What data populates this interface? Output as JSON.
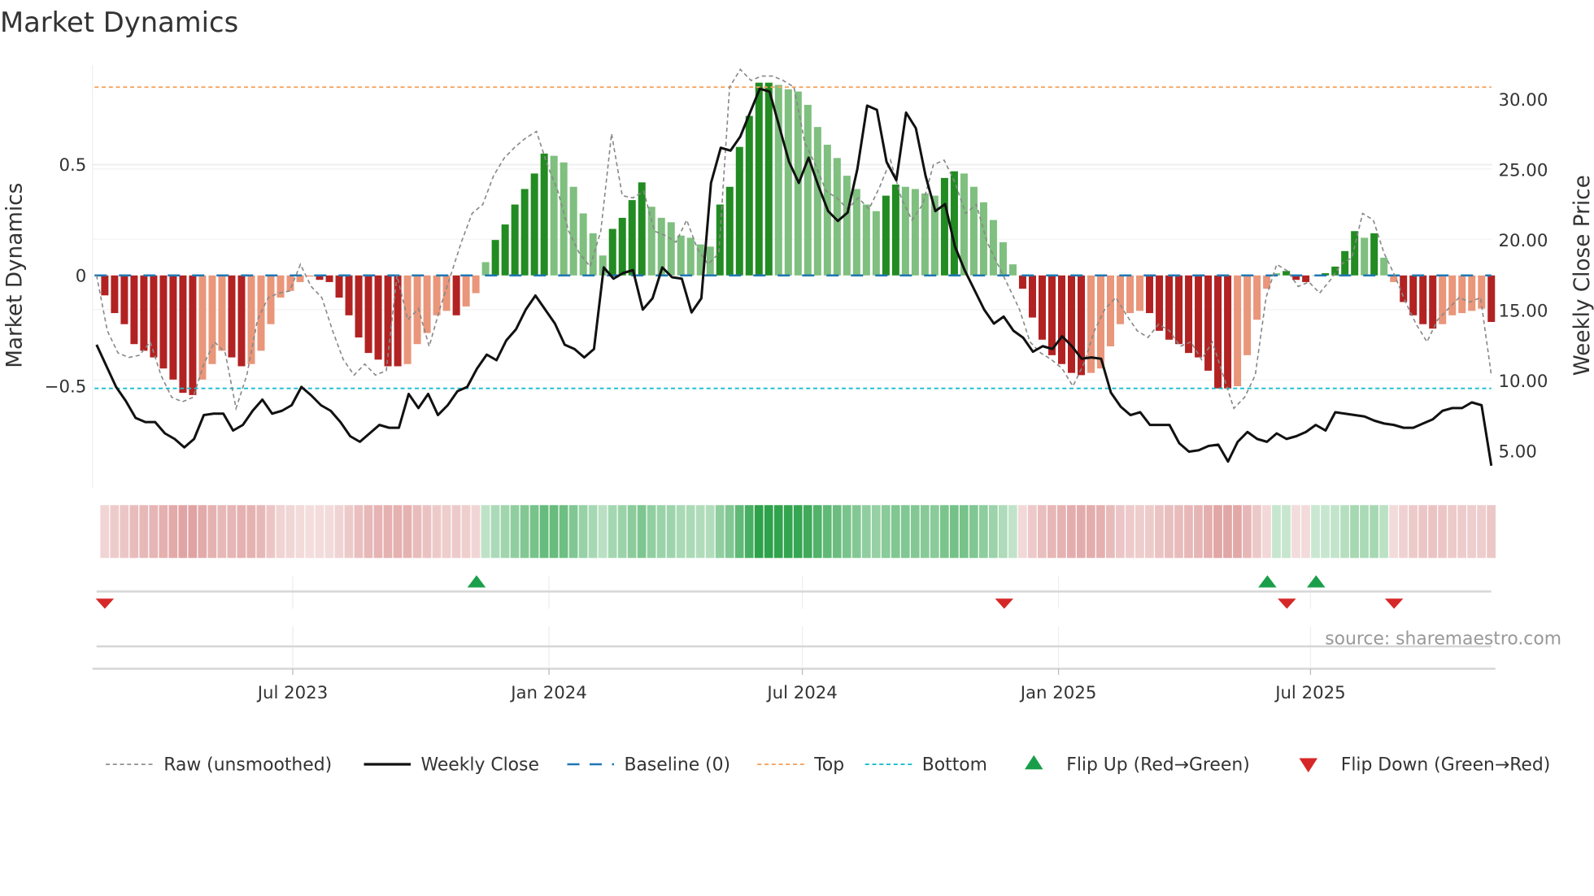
{
  "chart_data": {
    "type": "bar",
    "title": "Market Dynamics",
    "ylabel": "Market Dynamics",
    "y2label": "Weekly Close Price",
    "ylim": [
      -0.95,
      0.95
    ],
    "y2lim": [
      2.0,
      32.0
    ],
    "yticks": [
      {
        "v": 0.5,
        "label": "0.5"
      },
      {
        "v": 0,
        "label": "0"
      },
      {
        "v": -0.5,
        "label": "−0.5"
      }
    ],
    "y2ticks": [
      {
        "v": 30,
        "label": "30.00"
      },
      {
        "v": 25,
        "label": "25.00"
      },
      {
        "v": 20,
        "label": "20.00"
      },
      {
        "v": 15,
        "label": "15.00"
      },
      {
        "v": 10,
        "label": "10.00"
      },
      {
        "v": 5,
        "label": "5.00"
      }
    ],
    "xticks": [
      {
        "date": "2023-07-01",
        "label": "Jul 2023"
      },
      {
        "date": "2024-01-01",
        "label": "Jan 2024"
      },
      {
        "date": "2024-07-01",
        "label": "Jul 2024"
      },
      {
        "date": "2025-01-01",
        "label": "Jan 2025"
      },
      {
        "date": "2025-07-01",
        "label": "Jul 2025"
      }
    ],
    "start_date": "2023-02-16",
    "end_date": "2025-10-17",
    "top_level": 0.85,
    "bottom_level": -0.51,
    "dynamics": [
      -0.09,
      -0.17,
      -0.22,
      -0.31,
      -0.34,
      -0.37,
      -0.42,
      -0.47,
      -0.53,
      -0.54,
      -0.47,
      -0.4,
      -0.34,
      -0.37,
      -0.41,
      -0.4,
      -0.34,
      -0.22,
      -0.1,
      -0.07,
      -0.03,
      -0.005,
      -0.02,
      -0.03,
      -0.1,
      -0.18,
      -0.28,
      -0.35,
      -0.38,
      -0.41,
      -0.41,
      -0.4,
      -0.31,
      -0.26,
      -0.18,
      -0.16,
      -0.18,
      -0.14,
      -0.08,
      0.06,
      0.16,
      0.23,
      0.32,
      0.39,
      0.46,
      0.55,
      0.54,
      0.51,
      0.4,
      0.28,
      0.19,
      0.09,
      0.21,
      0.26,
      0.34,
      0.42,
      0.31,
      0.26,
      0.24,
      0.18,
      0.17,
      0.14,
      0.13,
      0.32,
      0.4,
      0.58,
      0.72,
      0.87,
      0.87,
      0.86,
      0.84,
      0.83,
      0.77,
      0.67,
      0.59,
      0.53,
      0.45,
      0.39,
      0.32,
      0.29,
      0.36,
      0.41,
      0.4,
      0.39,
      0.37,
      0.36,
      0.44,
      0.47,
      0.46,
      0.4,
      0.33,
      0.25,
      0.15,
      0.05,
      -0.06,
      -0.19,
      -0.29,
      -0.36,
      -0.4,
      -0.44,
      -0.45,
      -0.44,
      -0.42,
      -0.32,
      -0.22,
      -0.17,
      -0.16,
      -0.17,
      -0.25,
      -0.29,
      -0.31,
      -0.35,
      -0.37,
      -0.43,
      -0.51,
      -0.51,
      -0.5,
      -0.36,
      -0.2,
      -0.06,
      0.01,
      0.02,
      -0.02,
      -0.03,
      0.0,
      0.01,
      0.04,
      0.11,
      0.2,
      0.17,
      0.19,
      0.08,
      -0.03,
      -0.12,
      -0.18,
      -0.22,
      -0.24,
      -0.22,
      -0.18,
      -0.17,
      -0.16,
      -0.15,
      -0.21
    ],
    "raw": [
      0,
      -0.25,
      -0.35,
      -0.37,
      -0.36,
      -0.3,
      -0.45,
      -0.55,
      -0.57,
      -0.55,
      -0.4,
      -0.3,
      -0.35,
      -0.6,
      -0.45,
      -0.2,
      -0.1,
      -0.08,
      -0.07,
      0.05,
      -0.05,
      -0.1,
      -0.25,
      -0.38,
      -0.45,
      -0.4,
      -0.45,
      -0.43,
      0,
      -0.2,
      -0.15,
      -0.32,
      -0.15,
      0,
      0.15,
      0.28,
      0.32,
      0.45,
      0.53,
      0.58,
      0.62,
      0.65,
      0.5,
      0.38,
      0.2,
      0.1,
      0.04,
      0.2,
      0.64,
      0.36,
      0.35,
      0.38,
      0.2,
      0.18,
      0.15,
      0.25,
      0.12,
      0.05,
      0.1,
      0.85,
      0.93,
      0.88,
      0.9,
      0.9,
      0.88,
      0.85,
      0.6,
      0.5,
      0.38,
      0.35,
      0.3,
      0.35,
      0.3,
      0.4,
      0.52,
      0.35,
      0.25,
      0.32,
      0.5,
      0.52,
      0.42,
      0.28,
      0.32,
      0.15,
      0.05,
      -0.05,
      -0.15,
      -0.3,
      -0.35,
      -0.38,
      -0.42,
      -0.5,
      -0.4,
      -0.25,
      -0.15,
      -0.1,
      -0.18,
      -0.25,
      -0.28,
      -0.22,
      -0.25,
      -0.32,
      -0.3,
      -0.38,
      -0.3,
      -0.45,
      -0.6,
      -0.55,
      -0.45,
      -0.1,
      0.05,
      0.02,
      -0.05,
      -0.03,
      -0.08,
      -0.02,
      0.05,
      0.08,
      0.28,
      0.25,
      0.1,
      0,
      -0.12,
      -0.22,
      -0.3,
      -0.2,
      -0.15,
      -0.1,
      -0.12,
      -0.1,
      -0.45
    ],
    "close": [
      12.5,
      11,
      9.5,
      8.5,
      7.3,
      7,
      7,
      6.2,
      5.8,
      5.2,
      5.8,
      7.5,
      7.6,
      7.6,
      6.4,
      6.8,
      7.8,
      8.6,
      7.6,
      7.8,
      8.2,
      9.5,
      8.9,
      8.2,
      7.8,
      7,
      6,
      5.6,
      6.2,
      6.8,
      6.6,
      6.6,
      9.0,
      8,
      9,
      7.5,
      8.2,
      9.2,
      9.5,
      10.8,
      11.8,
      11.4,
      12.8,
      13.6,
      15,
      16,
      15,
      14,
      12.5,
      12.2,
      11.6,
      12.2,
      18,
      17.2,
      17.6,
      17.8,
      15,
      15.8,
      18,
      17.3,
      17.2,
      14.8,
      15.8,
      24,
      26.5,
      26.3,
      27.3,
      29,
      30.7,
      30.5,
      28,
      25.5,
      24,
      25.8,
      23.8,
      22,
      21.3,
      21.9,
      25,
      29.5,
      29.2,
      25.5,
      24.2,
      29,
      27.9,
      24.5,
      22,
      22.5,
      19.5,
      17.8,
      16.4,
      15,
      14,
      14.5,
      13.5,
      13,
      12,
      12.4,
      12.2,
      13.1,
      12.4,
      11.5,
      11.6,
      11.5,
      9.1,
      8.1,
      7.5,
      7.7,
      6.8,
      6.8,
      6.8,
      5.5,
      4.9,
      5,
      5.3,
      5.4,
      4.2,
      5.6,
      6.3,
      5.8,
      5.6,
      6.2,
      5.8,
      6,
      6.3,
      6.8,
      6.4,
      7.7,
      7.6,
      7.5,
      7.4,
      7.1,
      6.9,
      6.8,
      6.6,
      6.6,
      6.9,
      7.2,
      7.8,
      8,
      8,
      8.4,
      8.2,
      3.9
    ],
    "flip_up": [
      "2023-11-10",
      "2025-05-31",
      "2025-07-05"
    ],
    "flip_down": [
      "2023-02-16",
      "2024-11-23",
      "2025-06-14",
      "2025-08-30"
    ],
    "legend": {
      "placement": "bottom",
      "items": [
        {
          "key": "raw",
          "label": "Raw (unsmoothed)"
        },
        {
          "key": "close",
          "label": "Weekly Close"
        },
        {
          "key": "baseline",
          "label": "Baseline (0)"
        },
        {
          "key": "top",
          "label": "Top"
        },
        {
          "key": "bottom",
          "label": "Bottom"
        },
        {
          "key": "flipup",
          "label": "Flip Up (Red→Green)"
        },
        {
          "key": "flipdown",
          "label": "Flip Down (Green→Red)"
        }
      ]
    },
    "source": "source: sharemaestro.com",
    "colors": {
      "green_dark": "#228b22",
      "green_light": "#7fbf7f",
      "red_dark": "#b22222",
      "red_light": "#e9967a",
      "close": "#111111",
      "raw": "#888888",
      "baseline": "#1f77b4",
      "top": "#f4a460",
      "bottom": "#17becf",
      "marker_up": "#1a9e4a",
      "marker_down": "#d62728"
    }
  }
}
